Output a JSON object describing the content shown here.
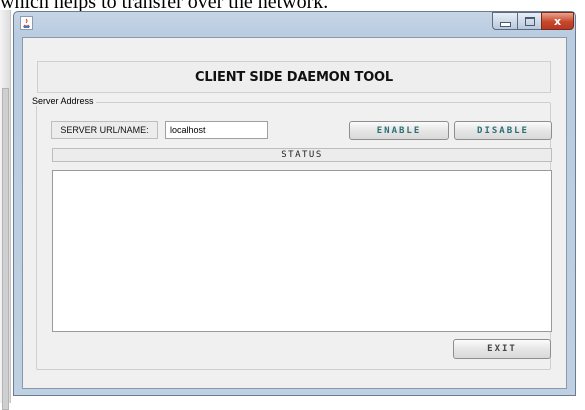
{
  "document": {
    "text_above": "which helps to transfer over the network."
  },
  "window": {
    "title": "",
    "close_symbol": "x"
  },
  "app": {
    "header_title": "CLIENT SIDE DAEMON TOOL",
    "server_group_label": "Server Address",
    "url_label": "SERVER URL/NAME:",
    "url_value": "localhost",
    "enable_label": "ENABLE",
    "disable_label": "DISABLE",
    "status_label": "STATUS",
    "status_text": "",
    "exit_label": "EXIT"
  },
  "icons": {
    "window_app": "java-icon",
    "minimize": "minimize-icon",
    "maximize": "maximize-icon",
    "close": "close-icon"
  },
  "colors": {
    "button_text_accent": "#2c6f73",
    "close_button": "#c7472b",
    "window_frame": "#b9cce0"
  }
}
